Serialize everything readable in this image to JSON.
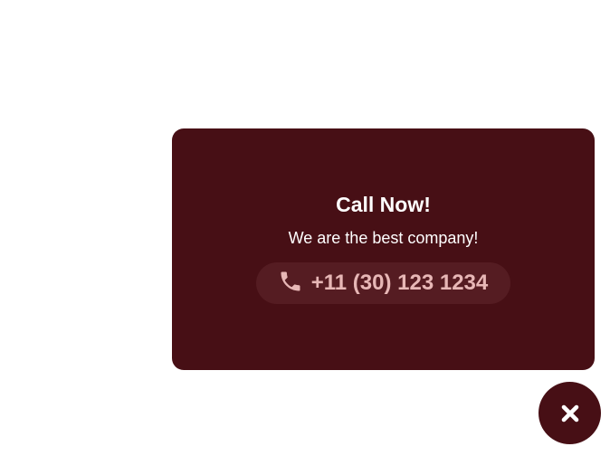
{
  "popup": {
    "title": "Call Now!",
    "subtitle": "We are the best company!",
    "phone": {
      "icon": "phone-icon",
      "number": "+11 (30) 123 1234"
    }
  },
  "close_button": {
    "icon": "close-icon"
  },
  "colors": {
    "card_background": "#470f15",
    "pill_background": "#551c22",
    "accent_text": "#e7b7b6",
    "text": "#ffffff"
  }
}
